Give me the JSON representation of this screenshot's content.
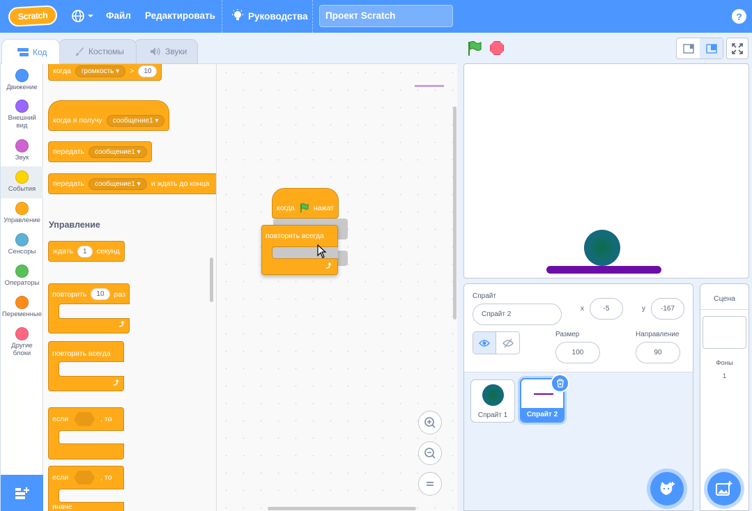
{
  "menubar": {
    "logo": "Scratch",
    "file": "Файл",
    "edit": "Редактировать",
    "tutorials": "Руководства",
    "project_title": "Проект Scratch",
    "help": "?"
  },
  "tabs": {
    "code": "Код",
    "costumes": "Костюмы",
    "sounds": "Звуки"
  },
  "categories": [
    {
      "label": "Движение",
      "color": "#4c97ff"
    },
    {
      "label": "Внешний вид",
      "color": "#9966ff"
    },
    {
      "label": "Звук",
      "color": "#cf63cf"
    },
    {
      "label": "События",
      "color": "#ffd500"
    },
    {
      "label": "Управление",
      "color": "#ffab19"
    },
    {
      "label": "Сенсоры",
      "color": "#5cb1d6"
    },
    {
      "label": "Операторы",
      "color": "#59c059"
    },
    {
      "label": "Переменные",
      "color": "#ff8c1a"
    },
    {
      "label": "Другие блоки",
      "color": "#ff6680"
    }
  ],
  "palette": {
    "when_loudness": {
      "text": "когда",
      "dropdown": "громкость",
      "op": ">",
      "value": "10"
    },
    "when_receive": {
      "text": "когда я получу",
      "dropdown": "сообщение1"
    },
    "broadcast": {
      "text": "передать",
      "dropdown": "сообщение1"
    },
    "broadcast_wait": {
      "text": "передать",
      "dropdown": "сообщение1",
      "suffix": "и ждать до конца"
    },
    "section_control": "Управление",
    "wait": {
      "text": "ждать",
      "value": "1",
      "suffix": "секунд"
    },
    "repeat": {
      "text": "повторить",
      "value": "10",
      "suffix": "раз"
    },
    "forever": {
      "text": "повторять всегда"
    },
    "if_then": {
      "text": "если",
      "suffix": ", то"
    },
    "if_else": {
      "text": "если",
      "suffix": ", то",
      "else": "иначе"
    }
  },
  "workspace": {
    "when_flag": {
      "text": "когда",
      "suffix": "нажат"
    },
    "forever": {
      "text": "повторять всегда"
    }
  },
  "sprite": {
    "label": "Спрайт",
    "name": "Спрайт 2",
    "x_label": "x",
    "x": "-5",
    "y_label": "y",
    "y": "-167",
    "size_label": "Размер",
    "size": "100",
    "direction_label": "Направление",
    "direction": "90"
  },
  "sprites": [
    {
      "name": "Спрайт 1"
    },
    {
      "name": "Спрайт 2"
    }
  ],
  "stage_pane": {
    "title": "Сцена",
    "backdrops_label": "Фоны",
    "backdrops_count": "1"
  }
}
